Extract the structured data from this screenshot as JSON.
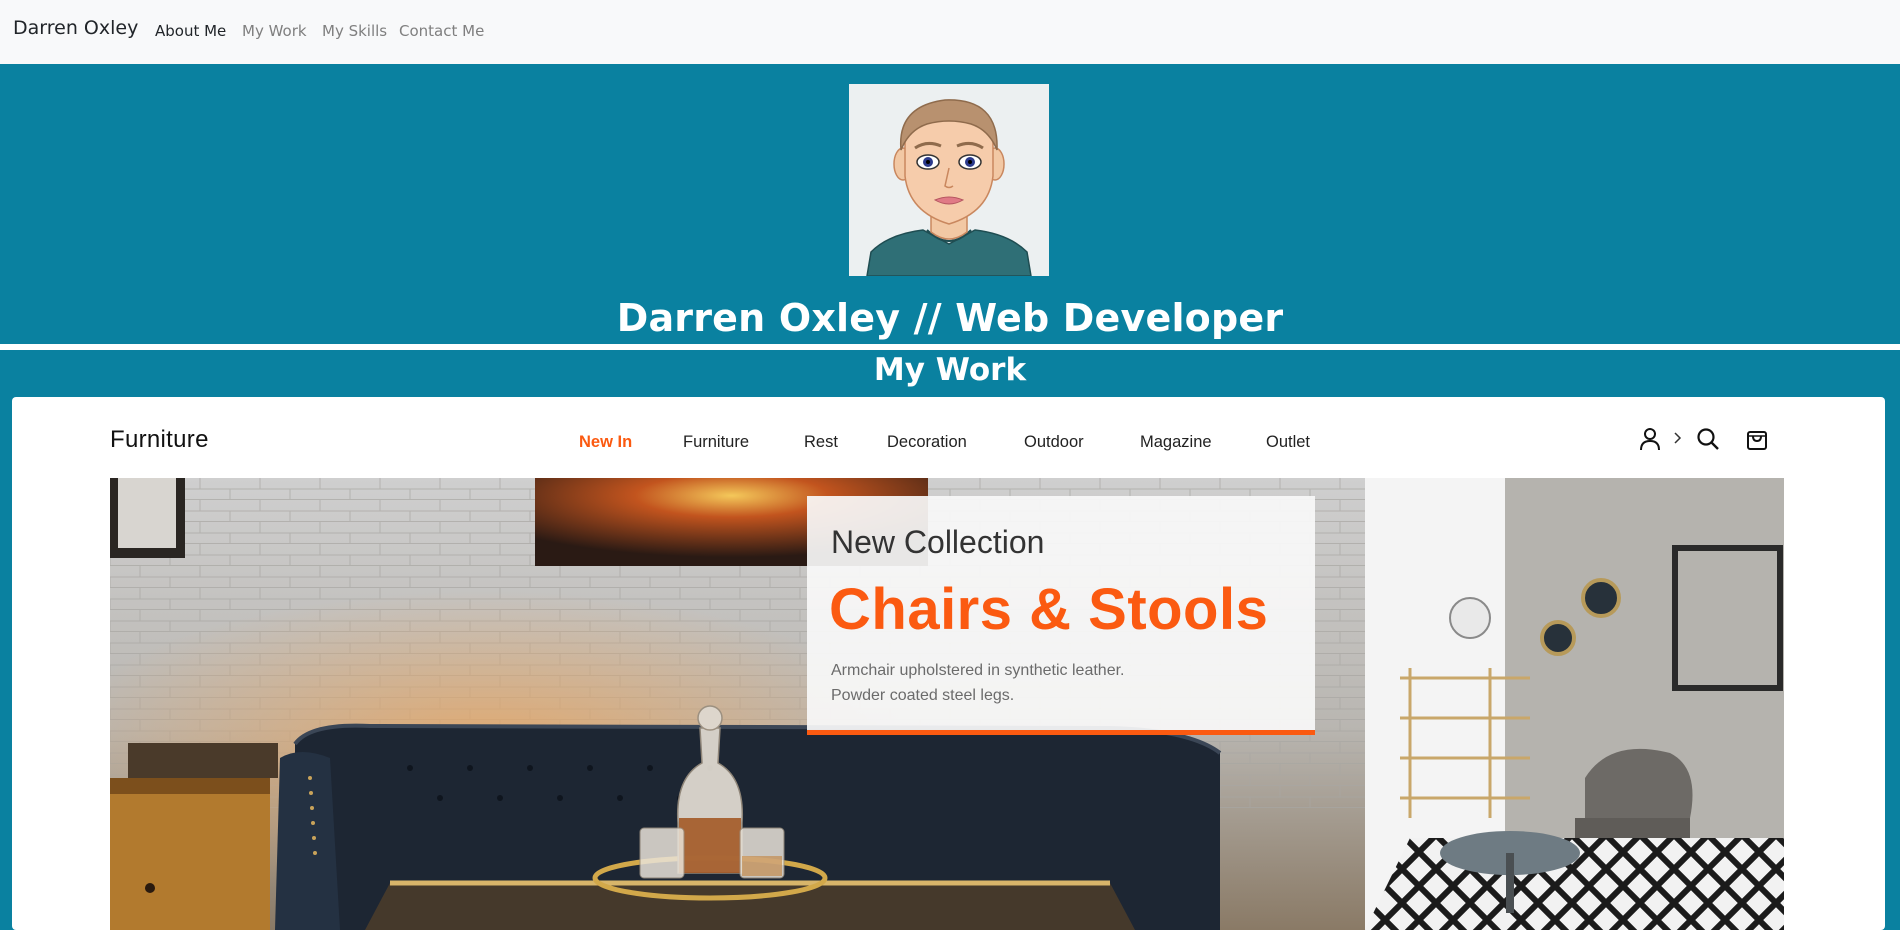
{
  "navbar": {
    "brand": "Darren Oxley",
    "links": [
      {
        "label": "About Me",
        "active": true
      },
      {
        "label": "My Work",
        "active": false
      },
      {
        "label": "My Skills",
        "active": false
      },
      {
        "label": "Contact Me",
        "active": false
      }
    ]
  },
  "hero": {
    "title": "Darren Oxley // Web Developer",
    "avatar_icon": "cartoon-avatar"
  },
  "work": {
    "title": "My Work"
  },
  "preview": {
    "logo": "Furniture",
    "nav": [
      "New In",
      "Furniture",
      "Rest",
      "Decoration",
      "Outdoor",
      "Magazine",
      "Outlet"
    ],
    "active_nav": "New In",
    "icons": [
      "user-icon",
      "chevron-right-icon",
      "search-icon",
      "shopping-bag-icon"
    ],
    "promo": {
      "kicker": "New Collection",
      "title": "Chairs & Stools",
      "desc_line1": "Armchair upholstered in synthetic leather.",
      "desc_line2": "Powder coated steel legs."
    }
  },
  "colors": {
    "teal": "#0a81a0",
    "accent": "#fb5a11",
    "navbar_bg": "#f8f9fa"
  }
}
